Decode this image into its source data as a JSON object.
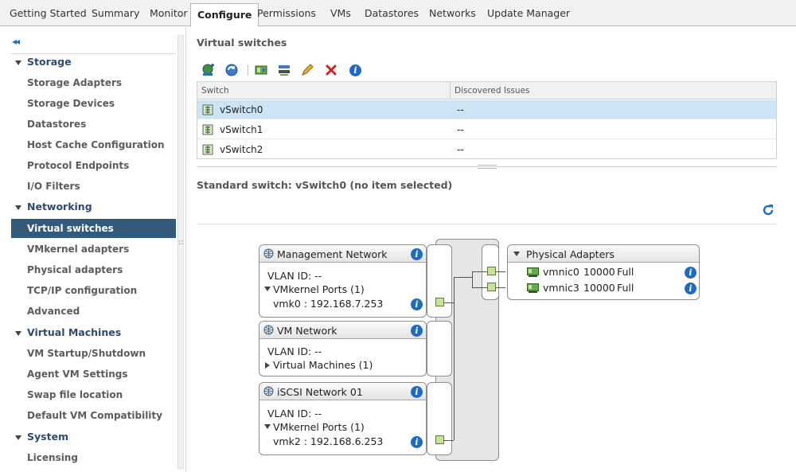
{
  "tabs": [
    {
      "label": "Getting Started"
    },
    {
      "label": "Summary"
    },
    {
      "label": "Monitor"
    },
    {
      "label": "Configure"
    },
    {
      "label": "Permissions"
    },
    {
      "label": "VMs"
    },
    {
      "label": "Datastores"
    },
    {
      "label": "Networks"
    },
    {
      "label": "Update Manager"
    }
  ],
  "sidebar": {
    "collapse_glyph": "◂◂",
    "groups": {
      "storage": "Storage",
      "networking": "Networking",
      "virtual_machines": "Virtual Machines",
      "system": "System"
    },
    "items": {
      "storage_adapters": "Storage Adapters",
      "storage_devices": "Storage Devices",
      "datastores": "Datastores",
      "host_cache": "Host Cache Configuration",
      "protocol_endpoints": "Protocol Endpoints",
      "io_filters": "I/O Filters",
      "virtual_switches": "Virtual switches",
      "vmkernel_adapters": "VMkernel adapters",
      "physical_adapters": "Physical adapters",
      "tcpip": "TCP/IP configuration",
      "advanced": "Advanced",
      "vm_startup": "VM Startup/Shutdown",
      "agent_vm": "Agent VM Settings",
      "swap_file": "Swap file location",
      "default_vm_compat": "Default VM Compatibility",
      "licensing": "Licensing"
    }
  },
  "main": {
    "title": "Virtual switches",
    "table": {
      "col_switch": "Switch",
      "col_issues": "Discovered Issues",
      "rows": [
        {
          "switch": "vSwitch0",
          "issues": "--"
        },
        {
          "switch": "vSwitch1",
          "issues": "--"
        },
        {
          "switch": "vSwitch2",
          "issues": "--"
        }
      ]
    },
    "detail_title": "Standard switch: vSwitch0 (no item selected)"
  },
  "diagram": {
    "mgmt": {
      "title": "Management Network",
      "vlan": "VLAN ID: --",
      "ports_label": "VMkernel Ports (1)",
      "port": "vmk0 : 192.168.7.253"
    },
    "vmnet": {
      "title": "VM Network",
      "vlan": "VLAN ID: --",
      "vms_label": "Virtual Machines (1)"
    },
    "iscsi": {
      "title": "iSCSI Network 01",
      "vlan": "VLAN ID: --",
      "ports_label": "VMkernel Ports (1)",
      "port": "vmk2 : 192.168.6.253"
    },
    "physical": {
      "title": "Physical Adapters",
      "nics": [
        {
          "name": "vmnic0",
          "speed": "10000",
          "duplex": "Full"
        },
        {
          "name": "vmnic3",
          "speed": "10000",
          "duplex": "Full"
        }
      ]
    }
  },
  "info_glyph": "i",
  "colors": {
    "selected_nav": "#315a7d",
    "selected_row": "#cde4f5",
    "info_blue": "#1f6bc4",
    "port_green": "#c6e39a"
  }
}
